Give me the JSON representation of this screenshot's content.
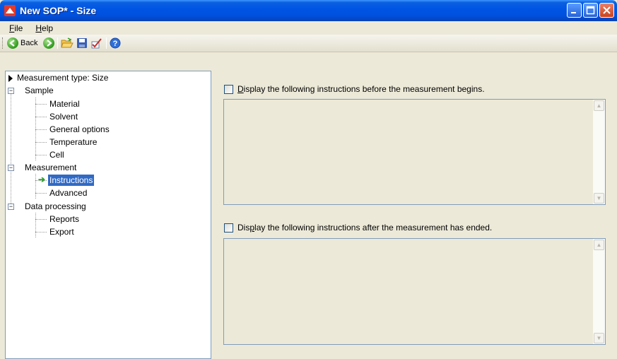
{
  "window": {
    "title": "New SOP* - Size"
  },
  "menu": [
    {
      "label": "File",
      "mnemonic": "F",
      "rest": "ile"
    },
    {
      "label": "Help",
      "mnemonic": "H",
      "rest": "elp"
    }
  ],
  "toolbar": {
    "back_label": "Back"
  },
  "tree": {
    "root": "Measurement type: Size",
    "sample": "Sample",
    "material": "Material",
    "solvent": "Solvent",
    "general_options": "General options",
    "temperature": "Temperature",
    "cell": "Cell",
    "measurement": "Measurement",
    "instructions": "Instructions",
    "advanced": "Advanced",
    "data_processing": "Data processing",
    "reports": "Reports",
    "export": "Export"
  },
  "options": {
    "before": {
      "pre": "",
      "mnemonic": "D",
      "post": "isplay the following instructions before the measurement begins.",
      "checked": false,
      "text": ""
    },
    "after": {
      "pre": "Dis",
      "mnemonic": "p",
      "post": "lay the following instructions after the measurement has ended.",
      "checked": false,
      "text": ""
    }
  },
  "colors": {
    "title_bar": "#0054e3",
    "selection": "#316ac5",
    "panel_bg": "#ece9d8"
  }
}
